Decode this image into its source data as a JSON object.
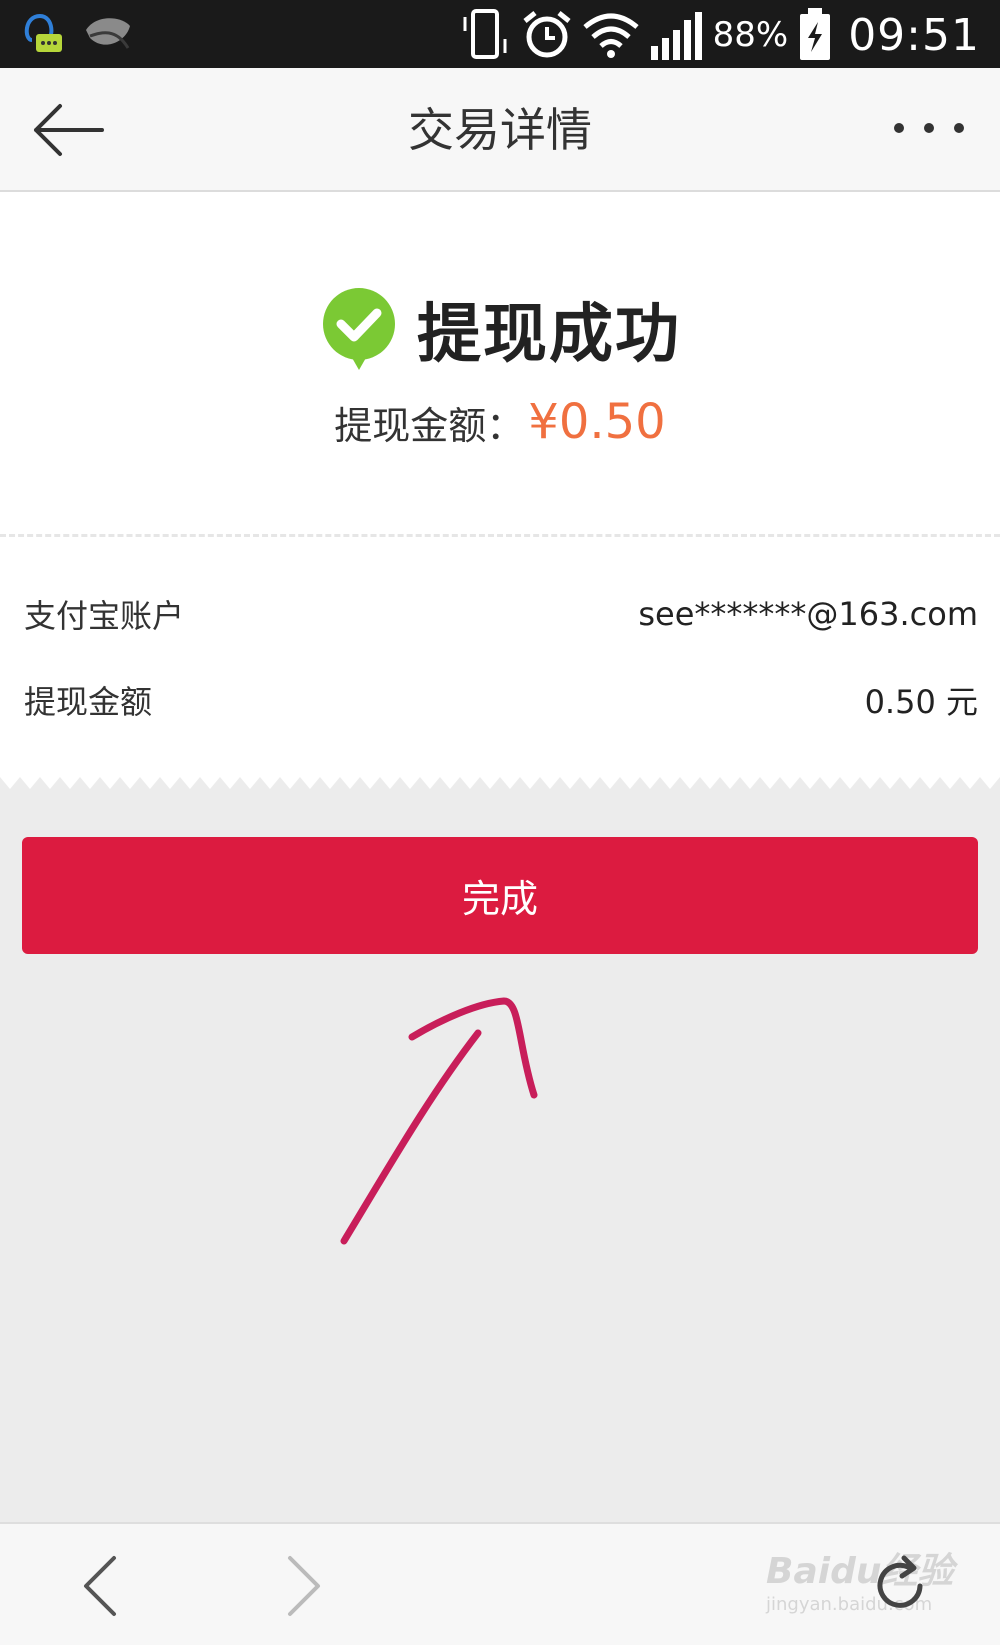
{
  "status_bar": {
    "battery_percent": "88%",
    "time": "09:51",
    "icons": [
      "qq-message-icon",
      "leaf-icon",
      "vibrate-icon",
      "alarm-icon",
      "wifi-icon",
      "signal-icon",
      "battery-charging-icon"
    ]
  },
  "nav": {
    "title": "交易详情",
    "back_icon": "arrow-left-icon",
    "more_icon": "more-dots-icon"
  },
  "result": {
    "title": "提现成功",
    "status_icon": "check-circle-icon",
    "amount_label": "提现金额：",
    "amount_value": "¥0.50"
  },
  "details": [
    {
      "label": "支付宝账户",
      "value": "see*******@163.com"
    },
    {
      "label": "提现金额",
      "value": "0.50 元"
    }
  ],
  "done_button": {
    "label": "完成"
  },
  "bottom_bar": {
    "back_icon": "chevron-left-icon",
    "forward_icon": "chevron-right-icon",
    "refresh_icon": "refresh-icon"
  },
  "watermark": {
    "line1": "Baidu经验",
    "line2": "jingyan.baidu.com"
  },
  "colors": {
    "accent_red": "#dc1b40",
    "amount_orange": "#f07040",
    "success_green": "#7bc934",
    "annotation": "#c81e5a"
  }
}
